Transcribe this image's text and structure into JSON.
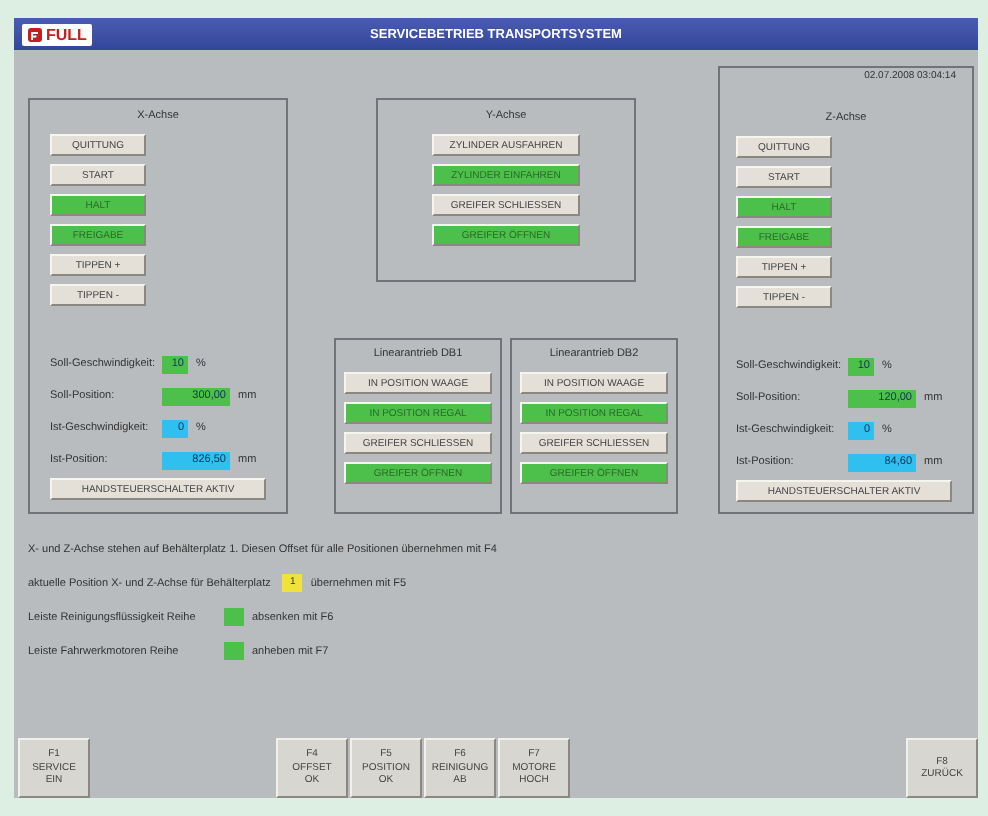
{
  "title_bar": {
    "logo": "FULL",
    "title": "SERVICEBETRIEB TRANSPORTSYSTEM"
  },
  "timestamp": "02.07.2008 03:04:14",
  "x_axis": {
    "title": "X-Achse",
    "buttons": [
      {
        "label": "QUITTUNG",
        "on": false
      },
      {
        "label": "START",
        "on": false
      },
      {
        "label": "HALT",
        "on": true
      },
      {
        "label": "FREIGABE",
        "on": true
      },
      {
        "label": "TIPPEN +",
        "on": false
      },
      {
        "label": "TIPPEN -",
        "on": false
      }
    ],
    "fields": [
      {
        "label": "Soll-Geschwindigkeit:",
        "kind": "set-speed",
        "value": "10",
        "unit": "%"
      },
      {
        "label": "Soll-Position:",
        "kind": "set-position",
        "value": "300,00",
        "unit": "mm"
      },
      {
        "label": "Ist-Geschwindigkeit:",
        "kind": "actual-speed",
        "value": "0",
        "unit": "%"
      },
      {
        "label": "Ist-Position:",
        "kind": "actual-position",
        "value": "826,50",
        "unit": "mm"
      }
    ],
    "mode_button": "HANDSTEUERSCHALTER AKTIV"
  },
  "y_axis": {
    "title": "Y-Achse",
    "buttons": [
      {
        "label": "ZYLINDER AUSFAHREN",
        "on": false
      },
      {
        "label": "ZYLINDER EINFAHREN",
        "on": true
      },
      {
        "label": "GREIFER SCHLIESSEN",
        "on": false
      },
      {
        "label": "GREIFER ÖFFNEN",
        "on": true
      }
    ]
  },
  "linear_drives": [
    {
      "title": "Linearantrieb DB1",
      "buttons": [
        {
          "label": "IN POSITION WAAGE",
          "on": false
        },
        {
          "label": "IN POSITION REGAL",
          "on": true
        },
        {
          "label": "GREIFER SCHLIESSEN",
          "on": false
        },
        {
          "label": "GREIFER ÖFFNEN",
          "on": true
        }
      ]
    },
    {
      "title": "Linearantrieb DB2",
      "buttons": [
        {
          "label": "IN POSITION WAAGE",
          "on": false
        },
        {
          "label": "IN POSITION REGAL",
          "on": true
        },
        {
          "label": "GREIFER SCHLIESSEN",
          "on": false
        },
        {
          "label": "GREIFER ÖFFNEN",
          "on": true
        }
      ]
    }
  ],
  "z_axis": {
    "title": "Z-Achse",
    "buttons": [
      {
        "label": "QUITTUNG",
        "on": false
      },
      {
        "label": "START",
        "on": false
      },
      {
        "label": "HALT",
        "on": true
      },
      {
        "label": "FREIGABE",
        "on": true
      },
      {
        "label": "TIPPEN +",
        "on": false
      },
      {
        "label": "TIPPEN -",
        "on": false
      }
    ],
    "fields": [
      {
        "label": "Soll-Geschwindigkeit:",
        "kind": "set-speed",
        "value": "10",
        "unit": "%"
      },
      {
        "label": "Soll-Position:",
        "kind": "set-position",
        "value": "120,00",
        "unit": "mm"
      },
      {
        "label": "Ist-Geschwindigkeit:",
        "kind": "actual-speed",
        "value": "0",
        "unit": "%"
      },
      {
        "label": "Ist-Position:",
        "kind": "actual-position",
        "value": "84,60",
        "unit": "mm"
      }
    ],
    "mode_button": "HANDSTEUERSCHALTER AKTIV"
  },
  "notes": [
    {
      "text": "X- und Z-Achse stehen auf Behälterplatz 1. Diesen Offset für alle Positionen übernehmen mit F4"
    },
    {
      "text": "aktuelle Position X- und Z-Achse für Behälterplatz",
      "indicator": {
        "value": "1",
        "color": "#efe23a"
      },
      "action": "übernehmen mit F5"
    },
    {
      "text": "Leiste Reinigungsflüssigkeit Reihe",
      "indicator": {
        "color": "#4cc04a"
      },
      "action": "absenken mit F6"
    },
    {
      "text": "Leiste Fahrwerkmotoren Reihe",
      "indicator": {
        "color": "#4cc04a"
      },
      "action": "anheben mit F7"
    }
  ],
  "function_keys_left": [
    {
      "key": "F1",
      "label": "SERVICE",
      "sub": "EIN"
    }
  ],
  "function_keys_center": [
    {
      "key": "F4",
      "label": "OFFSET",
      "sub": "OK"
    },
    {
      "key": "F5",
      "label": "POSITION",
      "sub": "OK"
    },
    {
      "key": "F6",
      "label": "REINIGUNG",
      "sub": "AB"
    },
    {
      "key": "F7",
      "label": "MOTORE",
      "sub": "HOCH"
    }
  ],
  "function_keys_right": [
    {
      "key": "F8",
      "label": "ZURÜCK"
    }
  ]
}
